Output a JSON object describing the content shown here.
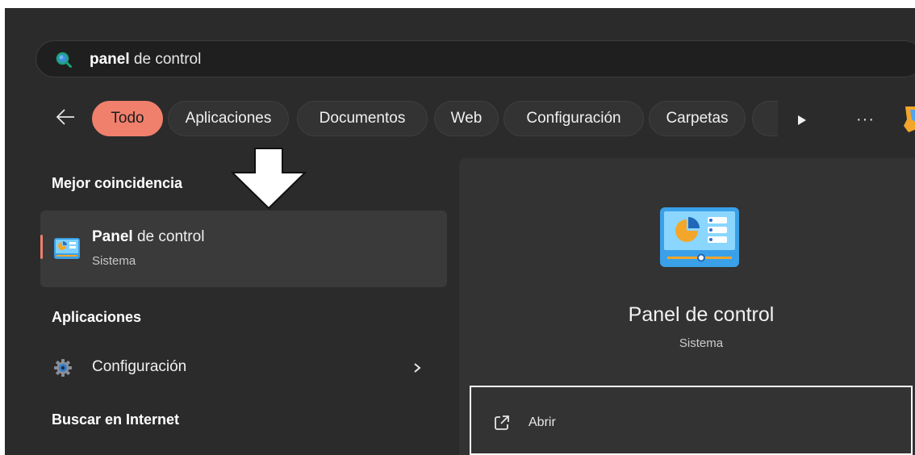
{
  "search": {
    "query_strong": "panel",
    "query_rest": " de control"
  },
  "filters": [
    {
      "label": "Todo",
      "active": true
    },
    {
      "label": "Aplicaciones",
      "active": false
    },
    {
      "label": "Documentos",
      "active": false
    },
    {
      "label": "Web",
      "active": false
    },
    {
      "label": "Configuración",
      "active": false
    },
    {
      "label": "Carpetas",
      "active": false
    }
  ],
  "more_label": "···",
  "left": {
    "best_match_title": "Mejor coincidencia",
    "best_match": {
      "name_strong": "Panel",
      "name_rest": " de control",
      "subtitle": "Sistema",
      "icon": "control-panel-icon"
    },
    "apps_title": "Aplicaciones",
    "apps": [
      {
        "label": "Configuración",
        "icon": "gear-icon"
      }
    ],
    "web_title": "Buscar en Internet"
  },
  "detail": {
    "title": "Panel de control",
    "subtitle": "Sistema",
    "actions": [
      {
        "label": "Abrir",
        "icon": "open-external-icon"
      }
    ]
  },
  "colors": {
    "accent": "#f0806c",
    "background": "#2b2b2b",
    "pane": "#333333"
  }
}
